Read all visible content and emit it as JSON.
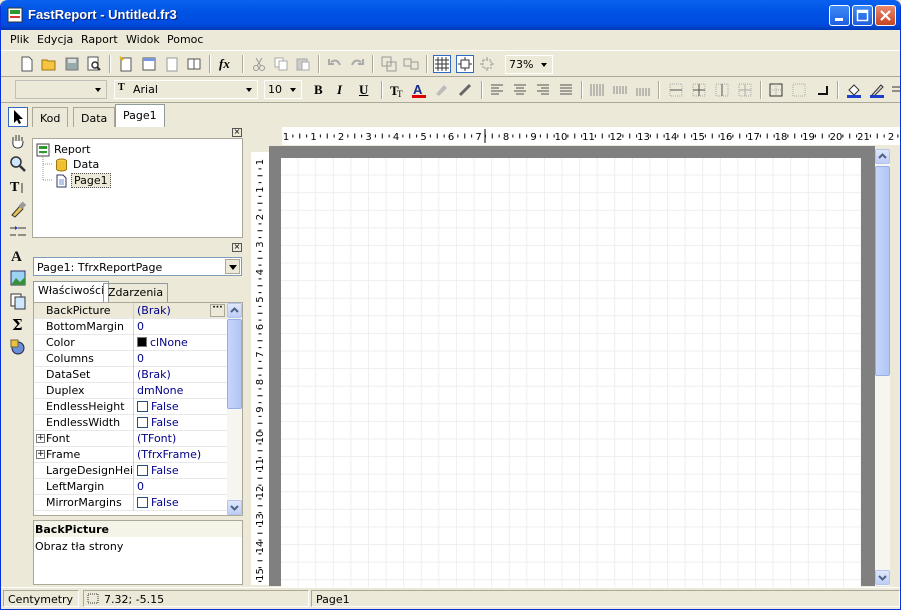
{
  "window": {
    "title": "FastReport - Untitled.fr3"
  },
  "menu": [
    "Plik",
    "Edycja",
    "Raport",
    "Widok",
    "Pomoc"
  ],
  "toolbar": {
    "zoom": "73%",
    "font_name": "Arial",
    "font_size": "10",
    "bold": "B",
    "italic": "I",
    "underline": "U",
    "fx": "fx"
  },
  "tabs": [
    "Kod",
    "Data",
    "Page1"
  ],
  "tree": {
    "root": "Report",
    "children": [
      "Data",
      "Page1"
    ]
  },
  "object_inspector": {
    "selected": "Page1: TfrxReportPage",
    "tabs": [
      "Właściwości",
      "Zdarzenia"
    ],
    "properties": [
      {
        "name": "BackPicture",
        "value": "(Brak)"
      },
      {
        "name": "BottomMargin",
        "value": "0"
      },
      {
        "name": "Color",
        "value": "clNone"
      },
      {
        "name": "Columns",
        "value": "0"
      },
      {
        "name": "DataSet",
        "value": "(Brak)"
      },
      {
        "name": "Duplex",
        "value": "dmNone"
      },
      {
        "name": "EndlessHeight",
        "value": "False"
      },
      {
        "name": "EndlessWidth",
        "value": "False"
      },
      {
        "name": "Font",
        "value": "(TFont)"
      },
      {
        "name": "Frame",
        "value": "(TfrxFrame)"
      },
      {
        "name": "LargeDesignHeight",
        "value": "False"
      },
      {
        "name": "LeftMargin",
        "value": "0"
      },
      {
        "name": "MirrorMargins",
        "value": "False"
      }
    ],
    "description_title": "BackPicture",
    "description_text": "Obraz tła strony"
  },
  "ruler": {
    "h_ticks": [
      "1",
      "1",
      "2",
      "3",
      "4",
      "5",
      "6",
      "7",
      "8",
      "9",
      "10",
      "11",
      "12",
      "13",
      "14",
      "15",
      "16",
      "17",
      "18",
      "19",
      "20",
      "21",
      "2"
    ],
    "v_ticks": [
      "1",
      "1",
      "2",
      "3",
      "4",
      "5",
      "6",
      "7",
      "8",
      "9",
      "10",
      "11",
      "12",
      "13",
      "14",
      "15"
    ]
  },
  "status": {
    "units": "Centymetry",
    "coords": "7.32; -5.15",
    "page": "Page1"
  },
  "colors": {
    "title_bar": "#0053e4",
    "workspace": "#808080",
    "face": "#ece9d8"
  }
}
